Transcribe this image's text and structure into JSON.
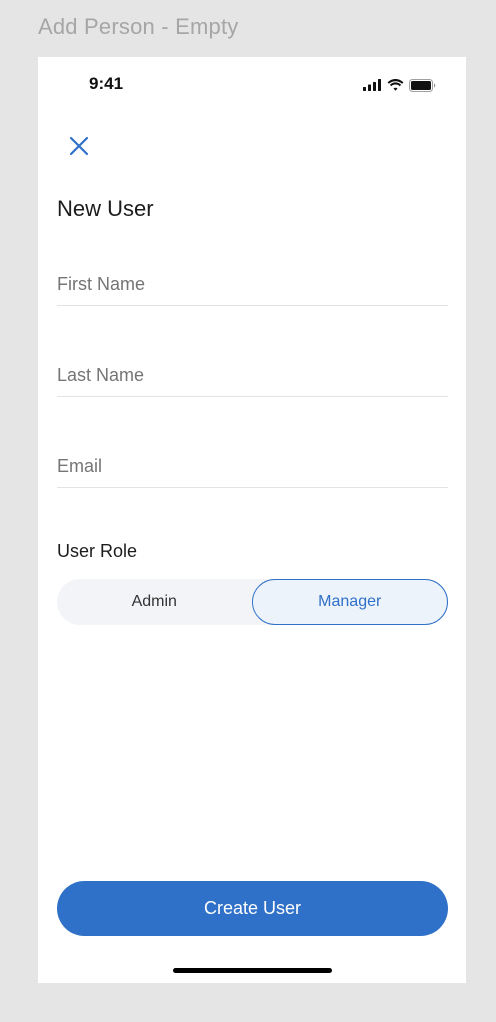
{
  "frame": {
    "label": "Add Person - Empty"
  },
  "status_bar": {
    "time": "9:41",
    "icons": [
      "cellular-signal-icon",
      "wifi-icon",
      "battery-icon"
    ]
  },
  "header": {
    "close_icon": "close-icon",
    "title": "New User"
  },
  "form": {
    "first_name": {
      "placeholder": "First Name",
      "value": ""
    },
    "last_name": {
      "placeholder": "Last Name",
      "value": ""
    },
    "email": {
      "placeholder": "Email",
      "value": ""
    },
    "role": {
      "label": "User Role",
      "options": [
        "Admin",
        "Manager"
      ],
      "selected": "Manager"
    }
  },
  "actions": {
    "create_label": "Create User"
  },
  "colors": {
    "accent": "#2f70c8",
    "segment_bg": "#f2f4f7",
    "segment_selected_bg": "#edf3fb",
    "canvas_bg": "#e5e5e5",
    "frame_label": "#a6a6a6"
  }
}
